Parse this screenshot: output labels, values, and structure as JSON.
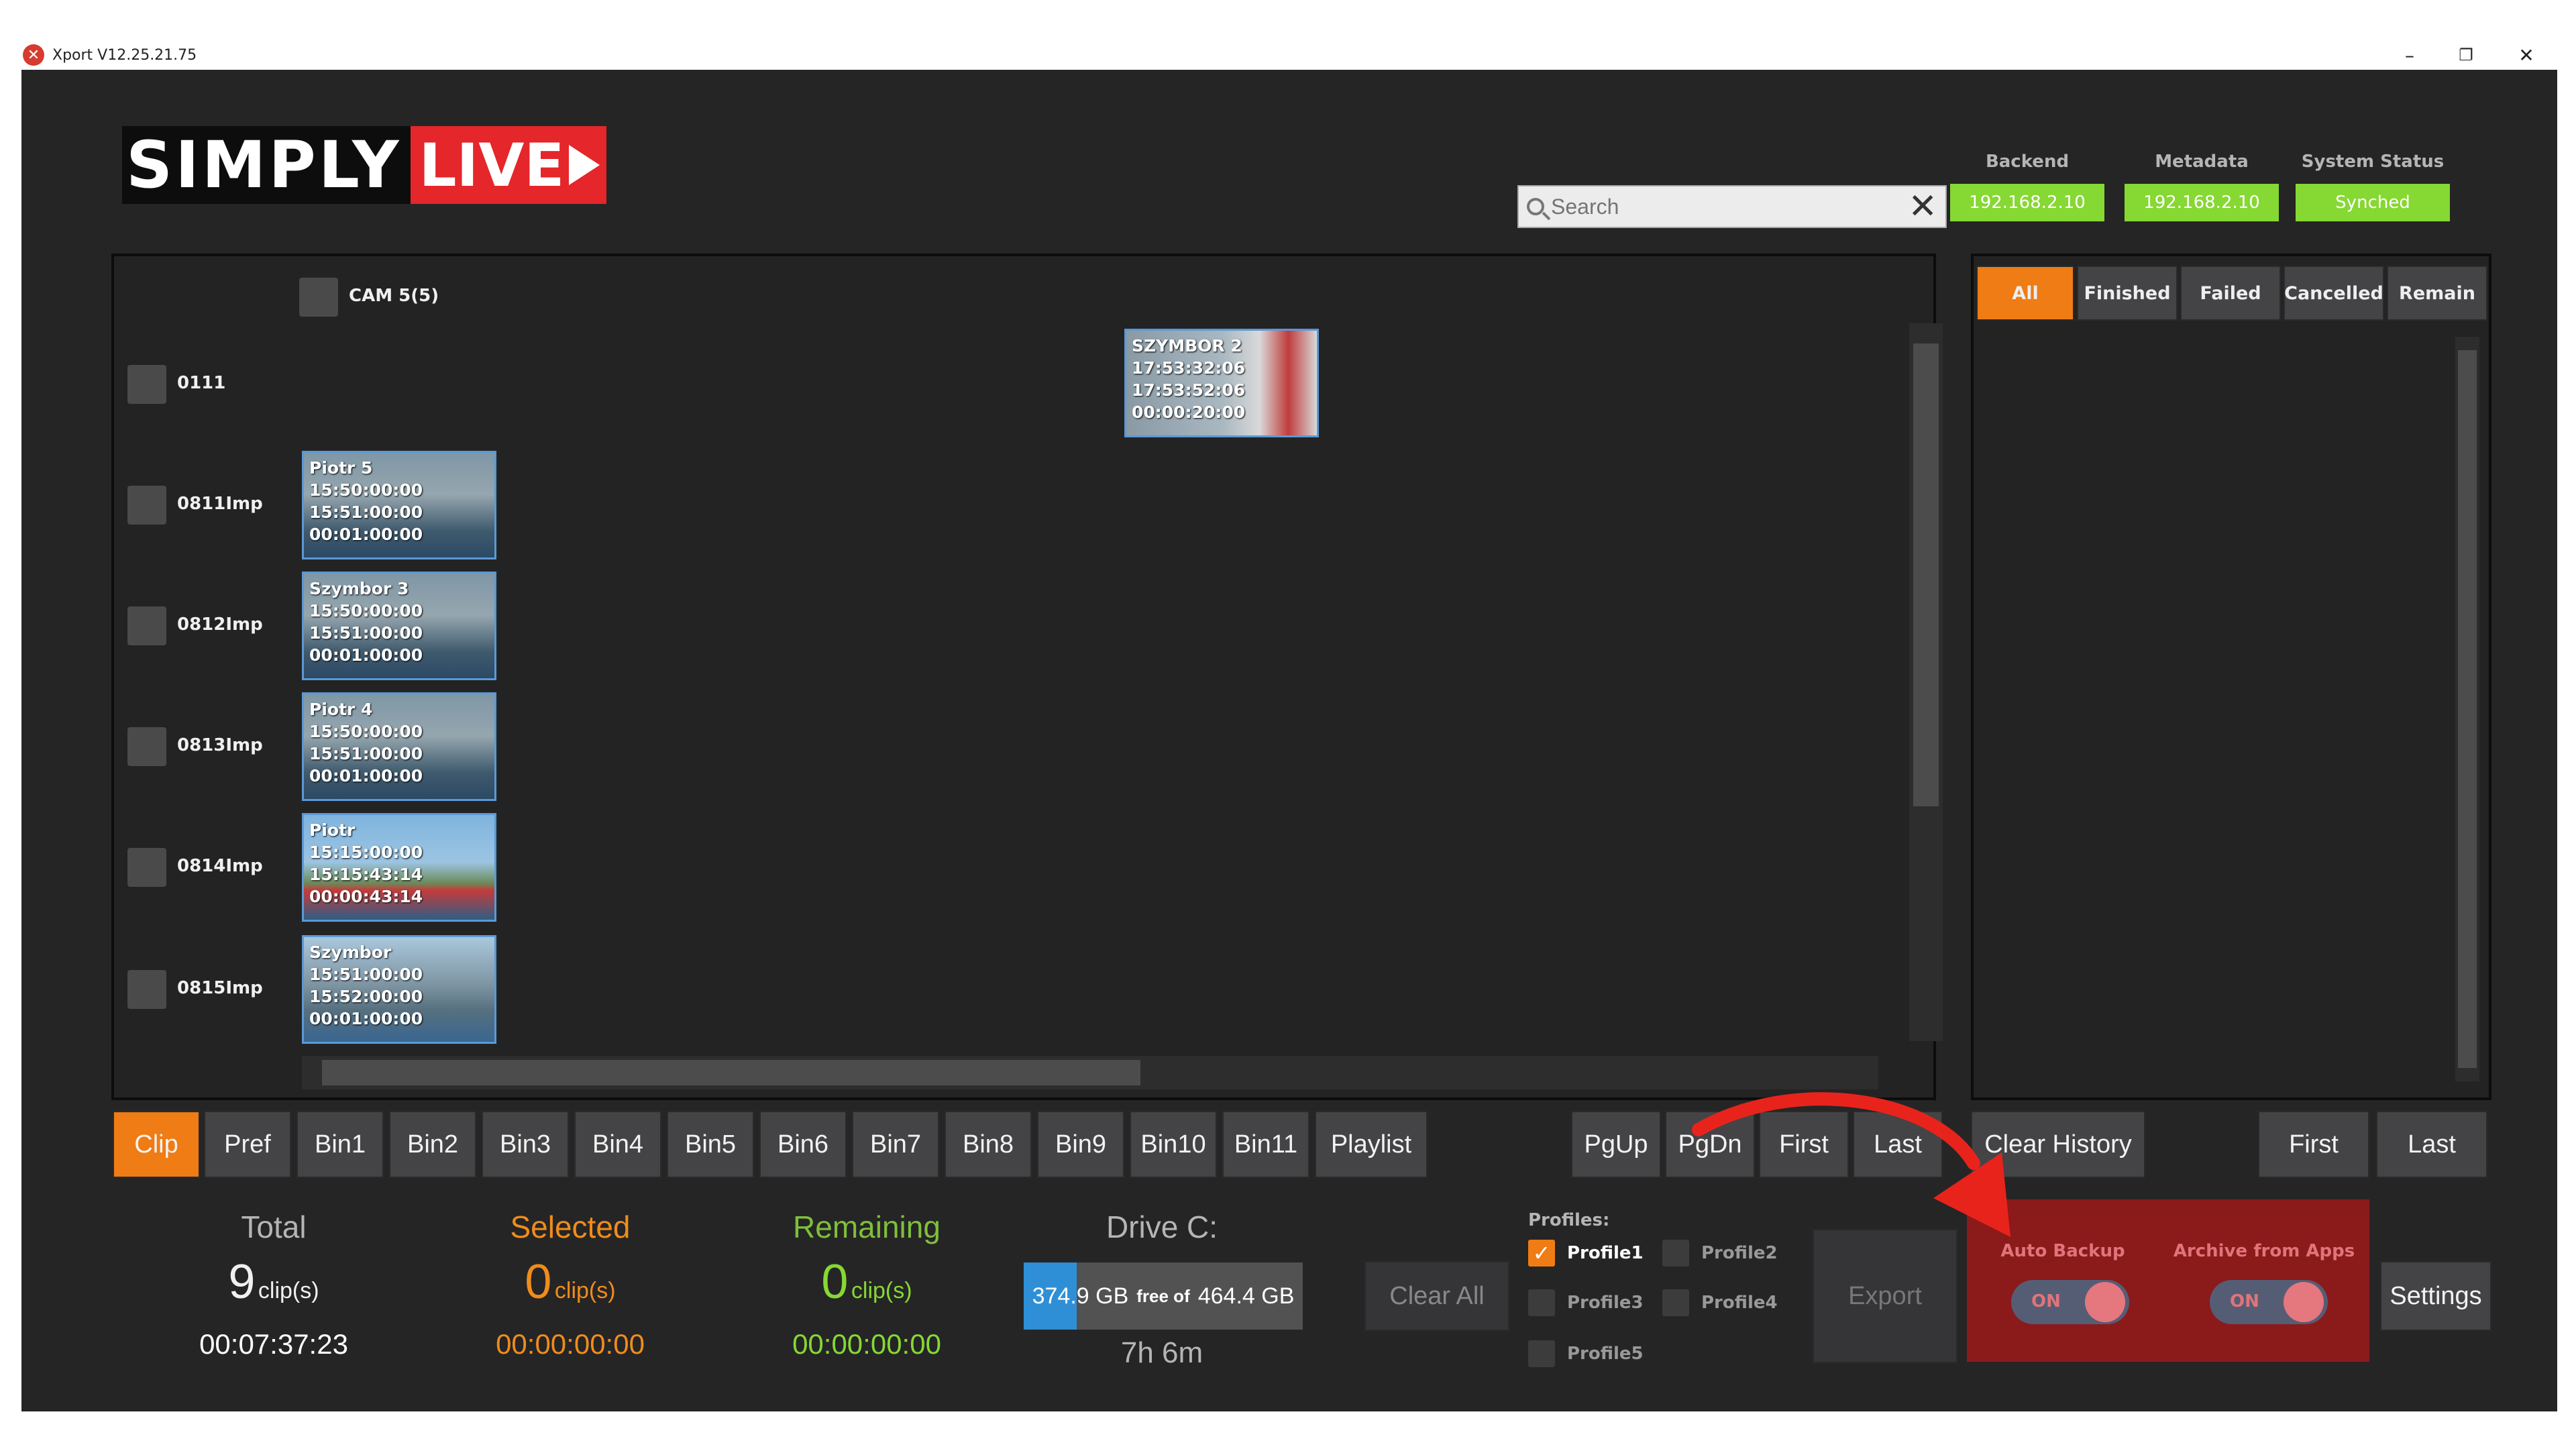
{
  "window": {
    "title": "Xport V12.25.21.75",
    "minimize": "–",
    "restore": "❐",
    "close": "✕"
  },
  "logo": {
    "simply": "SIMPLY",
    "live": "LIVE"
  },
  "search": {
    "placeholder": "Search",
    "clear": "✕"
  },
  "status": {
    "backend": {
      "label": "Backend",
      "value": "192.168.2.10"
    },
    "metadata": {
      "label": "Metadata",
      "value": "192.168.2.10"
    },
    "system": {
      "label": "System Status",
      "value": "Synched"
    },
    "color_ok": "#86d832"
  },
  "grid": {
    "camera": {
      "label": "CAM 5(5)"
    },
    "rows": [
      {
        "label": "0111"
      },
      {
        "label": "0811Imp"
      },
      {
        "label": "0812Imp"
      },
      {
        "label": "0813Imp"
      },
      {
        "label": "0814Imp"
      },
      {
        "label": "0815Imp"
      }
    ],
    "clips": [
      {
        "name": "SZYMBOR 2",
        "in": "17:53:32:06",
        "out": "17:53:52:06",
        "dur": "00:00:20:00"
      },
      {
        "name": "Piotr 5",
        "in": "15:50:00:00",
        "out": "15:51:00:00",
        "dur": "00:01:00:00"
      },
      {
        "name": "Szymbor 3",
        "in": "15:50:00:00",
        "out": "15:51:00:00",
        "dur": "00:01:00:00"
      },
      {
        "name": "Piotr 4",
        "in": "15:50:00:00",
        "out": "15:51:00:00",
        "dur": "00:01:00:00"
      },
      {
        "name": "Piotr",
        "in": "15:15:00:00",
        "out": "15:15:43:14",
        "dur": "00:00:43:14"
      },
      {
        "name": "Szymbor",
        "in": "15:51:00:00",
        "out": "15:52:00:00",
        "dur": "00:01:00:00"
      }
    ]
  },
  "filters": {
    "all": "All",
    "finished": "Finished",
    "failed": "Failed",
    "cancelled": "Cancelled",
    "remain": "Remain"
  },
  "tabs": [
    "Clip",
    "Pref",
    "Bin1",
    "Bin2",
    "Bin3",
    "Bin4",
    "Bin5",
    "Bin6",
    "Bin7",
    "Bin8",
    "Bin9",
    "Bin10",
    "Bin11",
    "Playlist"
  ],
  "nav": {
    "pgup": "PgUp",
    "pgdn": "PgDn",
    "first": "First",
    "last": "Last"
  },
  "history": {
    "clear": "Clear History",
    "first": "First",
    "last": "Last"
  },
  "summary": {
    "total": {
      "label": "Total",
      "count": "9",
      "unit": "clip(s)",
      "time": "00:07:37:23"
    },
    "selected": {
      "label": "Selected",
      "count": "0",
      "unit": "clip(s)",
      "time": "00:00:00:00"
    },
    "remaining": {
      "label": "Remaining",
      "count": "0",
      "unit": "clip(s)",
      "time": "00:00:00:00"
    }
  },
  "drive": {
    "label": "Drive C:",
    "free": "374.9 GB",
    "of_text": "free of",
    "total": "464.4 GB",
    "used_fraction": 0.19,
    "time_left": "7h 6m"
  },
  "clear_all": "Clear All",
  "profiles": {
    "label": "Profiles:",
    "items": [
      {
        "name": "Profile1",
        "checked": true
      },
      {
        "name": "Profile2",
        "checked": false
      },
      {
        "name": "Profile3",
        "checked": false
      },
      {
        "name": "Profile4",
        "checked": false
      },
      {
        "name": "Profile5",
        "checked": false
      }
    ]
  },
  "export": "Export",
  "backup": {
    "auto_backup": {
      "label": "Auto Backup",
      "state": "ON"
    },
    "archive": {
      "label": "Archive from Apps",
      "state": "ON"
    }
  },
  "settings": "Settings",
  "colors": {
    "accent": "#ef7c14",
    "highlight": "#8b1a1a",
    "annotation": "#e8231c",
    "clip_border": "#5b99d6"
  }
}
